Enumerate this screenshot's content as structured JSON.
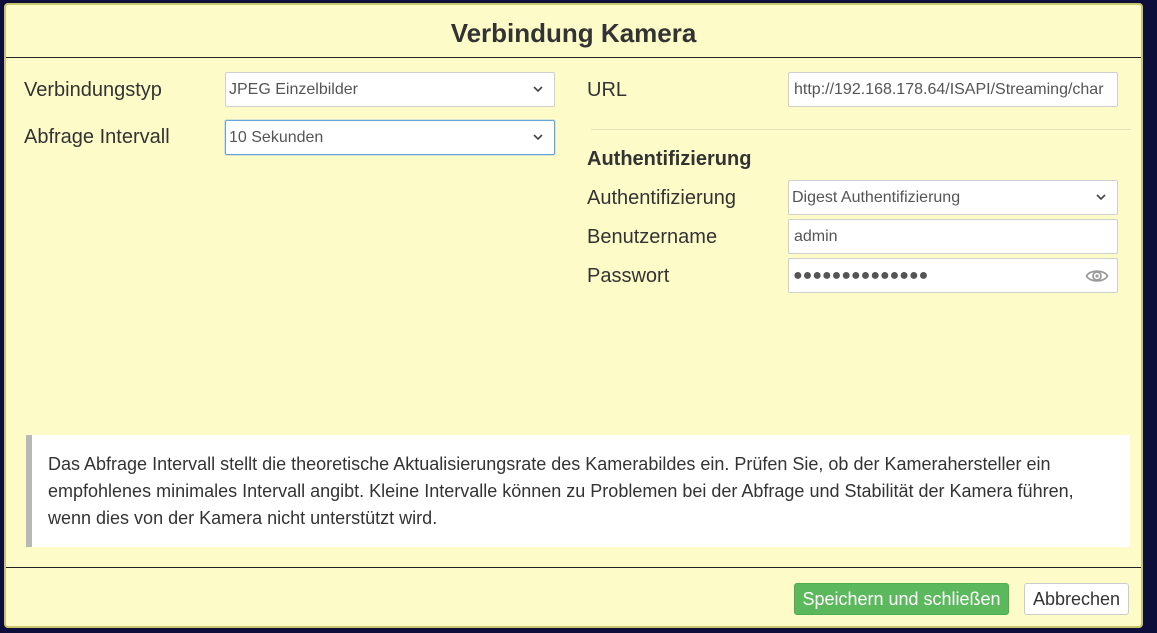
{
  "dialog": {
    "title": "Verbindung Kamera"
  },
  "left": {
    "connection_type_label": "Verbindungstyp",
    "connection_type_value": "JPEG Einzelbilder",
    "interval_label": "Abfrage Intervall",
    "interval_value": "10 Sekunden"
  },
  "right": {
    "url_label": "URL",
    "url_value": "http://192.168.178.64/ISAPI/Streaming/char",
    "auth_heading": "Authentifizierung",
    "auth_label": "Authentifizierung",
    "auth_value": "Digest Authentifizierung",
    "username_label": "Benutzername",
    "username_value": "admin",
    "password_label": "Passwort",
    "password_masked": "●●●●●●●●●●●●●●"
  },
  "info": {
    "text": "Das Abfrage Intervall stellt die theoretische Aktualisierungsrate des Kamerabildes ein. Prüfen Sie, ob der Kamerahersteller ein empfohlenes minimales Intervall angibt. Kleine Intervalle können zu Problemen bei der Abfrage und Stabilität der Kamera führen, wenn dies von der Kamera nicht unterstützt wird."
  },
  "footer": {
    "save_label": "Speichern und schließen",
    "cancel_label": "Abbrechen"
  },
  "colors": {
    "dialog_bg": "#fdfbc8",
    "save_button": "#5cb85c",
    "focus_border": "#66a3d9"
  },
  "icons": {
    "select_arrow": "chevron-down-icon",
    "password_toggle": "eye-icon"
  }
}
